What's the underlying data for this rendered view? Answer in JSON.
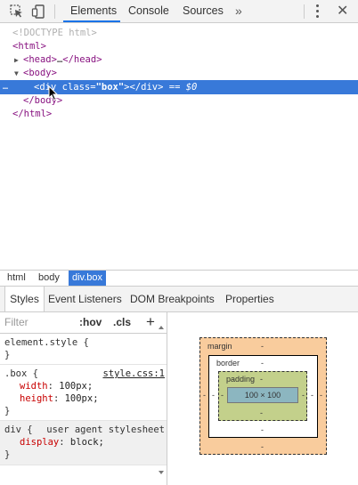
{
  "toolbar": {
    "tabs": [
      "Elements",
      "Console",
      "Sources"
    ],
    "overflow": "»",
    "close": "✕"
  },
  "dom": {
    "doctype": "<!DOCTYPE html>",
    "html_open": "<html>",
    "head_open": "<head>",
    "head_ellipsis": "…",
    "head_close": "</head>",
    "body_open": "<body>",
    "div_open": "<div",
    "attr_name": "class",
    "attr_val": "\"box\"",
    "div_close": "></div>",
    "dollar": " == $0",
    "body_close": "</body>",
    "html_close": "</html>",
    "dots": "…"
  },
  "breadcrumb": [
    "html",
    "body",
    "div.box"
  ],
  "subtabs": [
    "Styles",
    "Event Listeners",
    "DOM Breakpoints",
    "Properties"
  ],
  "styles": {
    "filter_placeholder": "Filter",
    "hov": ":hov",
    "cls": ".cls",
    "plus": "+",
    "element_style": "element.style {",
    "close_brace": "}",
    "box_selector": ".box {",
    "box_source": "style.css:1",
    "box_props": [
      {
        "name": "width",
        "value": "100px;"
      },
      {
        "name": "height",
        "value": "100px;"
      }
    ],
    "ua_selector": "div {",
    "ua_source": "user agent stylesheet",
    "ua_props": [
      {
        "name": "display",
        "value": "block;"
      }
    ]
  },
  "boxmodel": {
    "margin_label": "margin",
    "border_label": "border",
    "padding_label": "padding",
    "content": "100 × 100",
    "dash": "-",
    "colors": {
      "margin": "#f9cc9d",
      "padding": "#c3d08b",
      "content": "#8cb6c0"
    }
  },
  "colors": {
    "selection": "#3879d9",
    "accent": "#1a73e8"
  }
}
